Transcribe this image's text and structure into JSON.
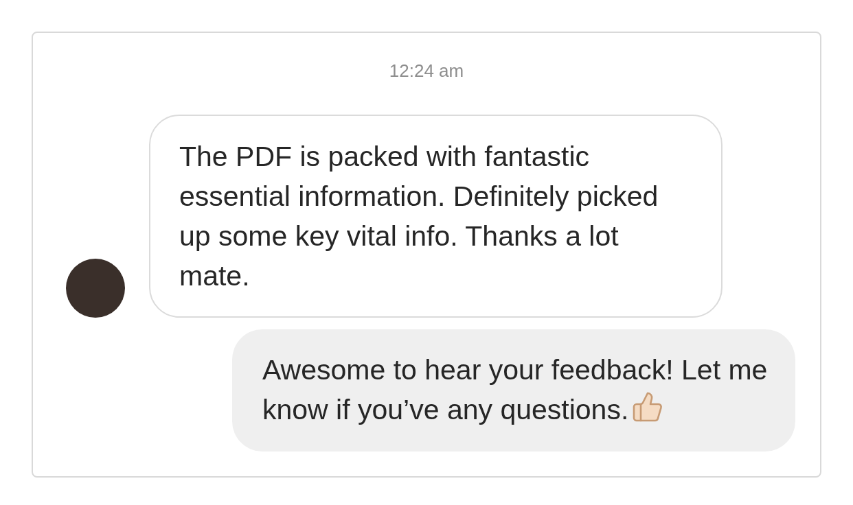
{
  "timestamp": "12:24 am",
  "messages": [
    {
      "kind": "incoming",
      "text": "The PDF is packed with fantastic essential information. Definitely picked up some key vital info. Thanks a lot mate.",
      "avatar": true,
      "emoji": false
    },
    {
      "kind": "outgoing",
      "text": "Awesome to hear your feedback! Let me know if you’ve any questions.",
      "avatar": false,
      "emoji": true
    }
  ]
}
